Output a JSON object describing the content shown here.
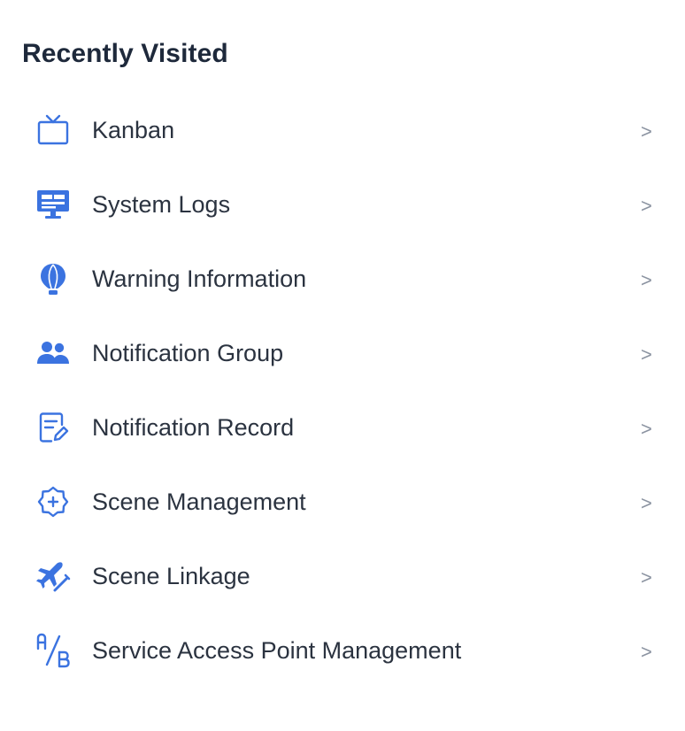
{
  "header": {
    "title": "Recently Visited"
  },
  "accent_color": "#3b73e0",
  "chevron_glyph": ">",
  "items": [
    {
      "label": "Kanban",
      "icon": "tv-icon"
    },
    {
      "label": "System Logs",
      "icon": "monitor-icon"
    },
    {
      "label": "Warning Information",
      "icon": "balloon-icon"
    },
    {
      "label": "Notification Group",
      "icon": "user-group-icon"
    },
    {
      "label": "Notification Record",
      "icon": "document-edit-icon"
    },
    {
      "label": "Scene Management",
      "icon": "settings-badge-icon"
    },
    {
      "label": "Scene Linkage",
      "icon": "airplane-icon"
    },
    {
      "label": "Service Access Point Management",
      "icon": "ab-test-icon"
    }
  ]
}
